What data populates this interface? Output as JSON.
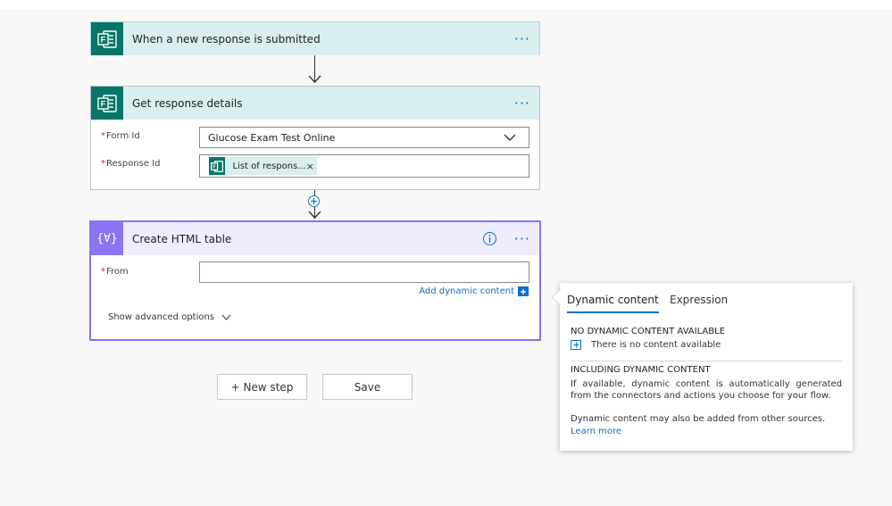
{
  "colors": {
    "forms_teal": "#077568",
    "forms_header_bg": "#d9efef",
    "data_op_purple": "#8b73f3",
    "data_op_header_bg": "#efecfd",
    "link_blue": "#0e6fcb",
    "required_red": "#c4262e"
  },
  "trigger_card": {
    "title": "When a new response is submitted",
    "icon": "microsoft-forms-icon",
    "more": "···"
  },
  "details_card": {
    "title": "Get response details",
    "icon": "microsoft-forms-icon",
    "more": "···",
    "form_id": {
      "required_mark": "*",
      "label": "Form Id",
      "value": "Glucose Exam Test Online",
      "dropdown_icon": "chevron-down-icon"
    },
    "response_id": {
      "required_mark": "*",
      "label": "Response Id",
      "token_label": "List of respons...",
      "token_remove": "×"
    }
  },
  "insert_step_icon": "plus-circle-icon",
  "html_card": {
    "title": "Create HTML table",
    "icon": "data-operation-icon",
    "icon_text": "{∀}",
    "info_icon": "info-icon",
    "more": "···",
    "from": {
      "required_mark": "*",
      "label": "From",
      "value": ""
    },
    "add_dynamic_content": "Add dynamic content",
    "advanced": "Show advanced options"
  },
  "buttons": {
    "new_step": "+ New step",
    "save": "Save"
  },
  "dynamic_panel": {
    "tabs": [
      "Dynamic content",
      "Expression"
    ],
    "active_tab": 0,
    "no_content_heading": "NO DYNAMIC CONTENT AVAILABLE",
    "no_content_text": "There is no content available",
    "including_heading": "INCLUDING DYNAMIC CONTENT",
    "including_text": "If available, dynamic content is automatically generated from the connectors and actions you choose for your flow.",
    "other_sources_text": "Dynamic content may also be added from other sources.",
    "learn_more": "Learn more"
  }
}
